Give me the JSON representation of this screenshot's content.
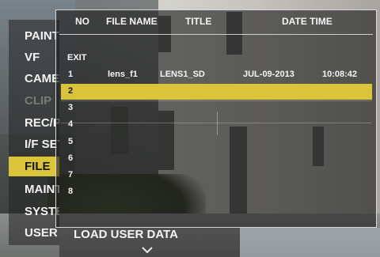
{
  "side_menu": {
    "items": [
      {
        "label": "PAINT",
        "state": "normal"
      },
      {
        "label": "VF",
        "state": "normal"
      },
      {
        "label": "CAMERA",
        "state": "normal"
      },
      {
        "label": "CLIP",
        "state": "disabled"
      },
      {
        "label": "REC/PB",
        "state": "normal"
      },
      {
        "label": "I/F SETUP",
        "state": "normal"
      },
      {
        "label": "FILE",
        "state": "selected"
      },
      {
        "label": "MAINTENANCE",
        "state": "normal"
      },
      {
        "label": "SYSTEM",
        "state": "normal"
      },
      {
        "label": "USER",
        "state": "normal"
      }
    ]
  },
  "file_table": {
    "headers": {
      "no": "NO",
      "file_name": "FILE NAME",
      "title": "TITLE",
      "date_time": "DATE TIME"
    },
    "exit_label": "EXIT",
    "rows": [
      {
        "no": "1",
        "file_name": "lens_f1",
        "title": "LENS1_SD",
        "date": "JUL-09-2013",
        "time": "10:08:42"
      },
      {
        "no": "2",
        "file_name": "",
        "title": "",
        "date": "",
        "time": ""
      },
      {
        "no": "3",
        "file_name": "",
        "title": "",
        "date": "",
        "time": ""
      },
      {
        "no": "4",
        "file_name": "",
        "title": "",
        "date": "",
        "time": ""
      },
      {
        "no": "5",
        "file_name": "",
        "title": "",
        "date": "",
        "time": ""
      },
      {
        "no": "6",
        "file_name": "",
        "title": "",
        "date": "",
        "time": ""
      },
      {
        "no": "7",
        "file_name": "",
        "title": "",
        "date": "",
        "time": ""
      },
      {
        "no": "8",
        "file_name": "",
        "title": "",
        "date": "",
        "time": ""
      }
    ],
    "selected_row_no": "2"
  },
  "bottom_bar": {
    "label": "LOAD USER DATA",
    "scroll_icon": "chevron-down-icon"
  },
  "colors": {
    "highlight": "#d9c43a",
    "text": "#f4f4f4",
    "disabled_text": "#7a7a7a"
  }
}
